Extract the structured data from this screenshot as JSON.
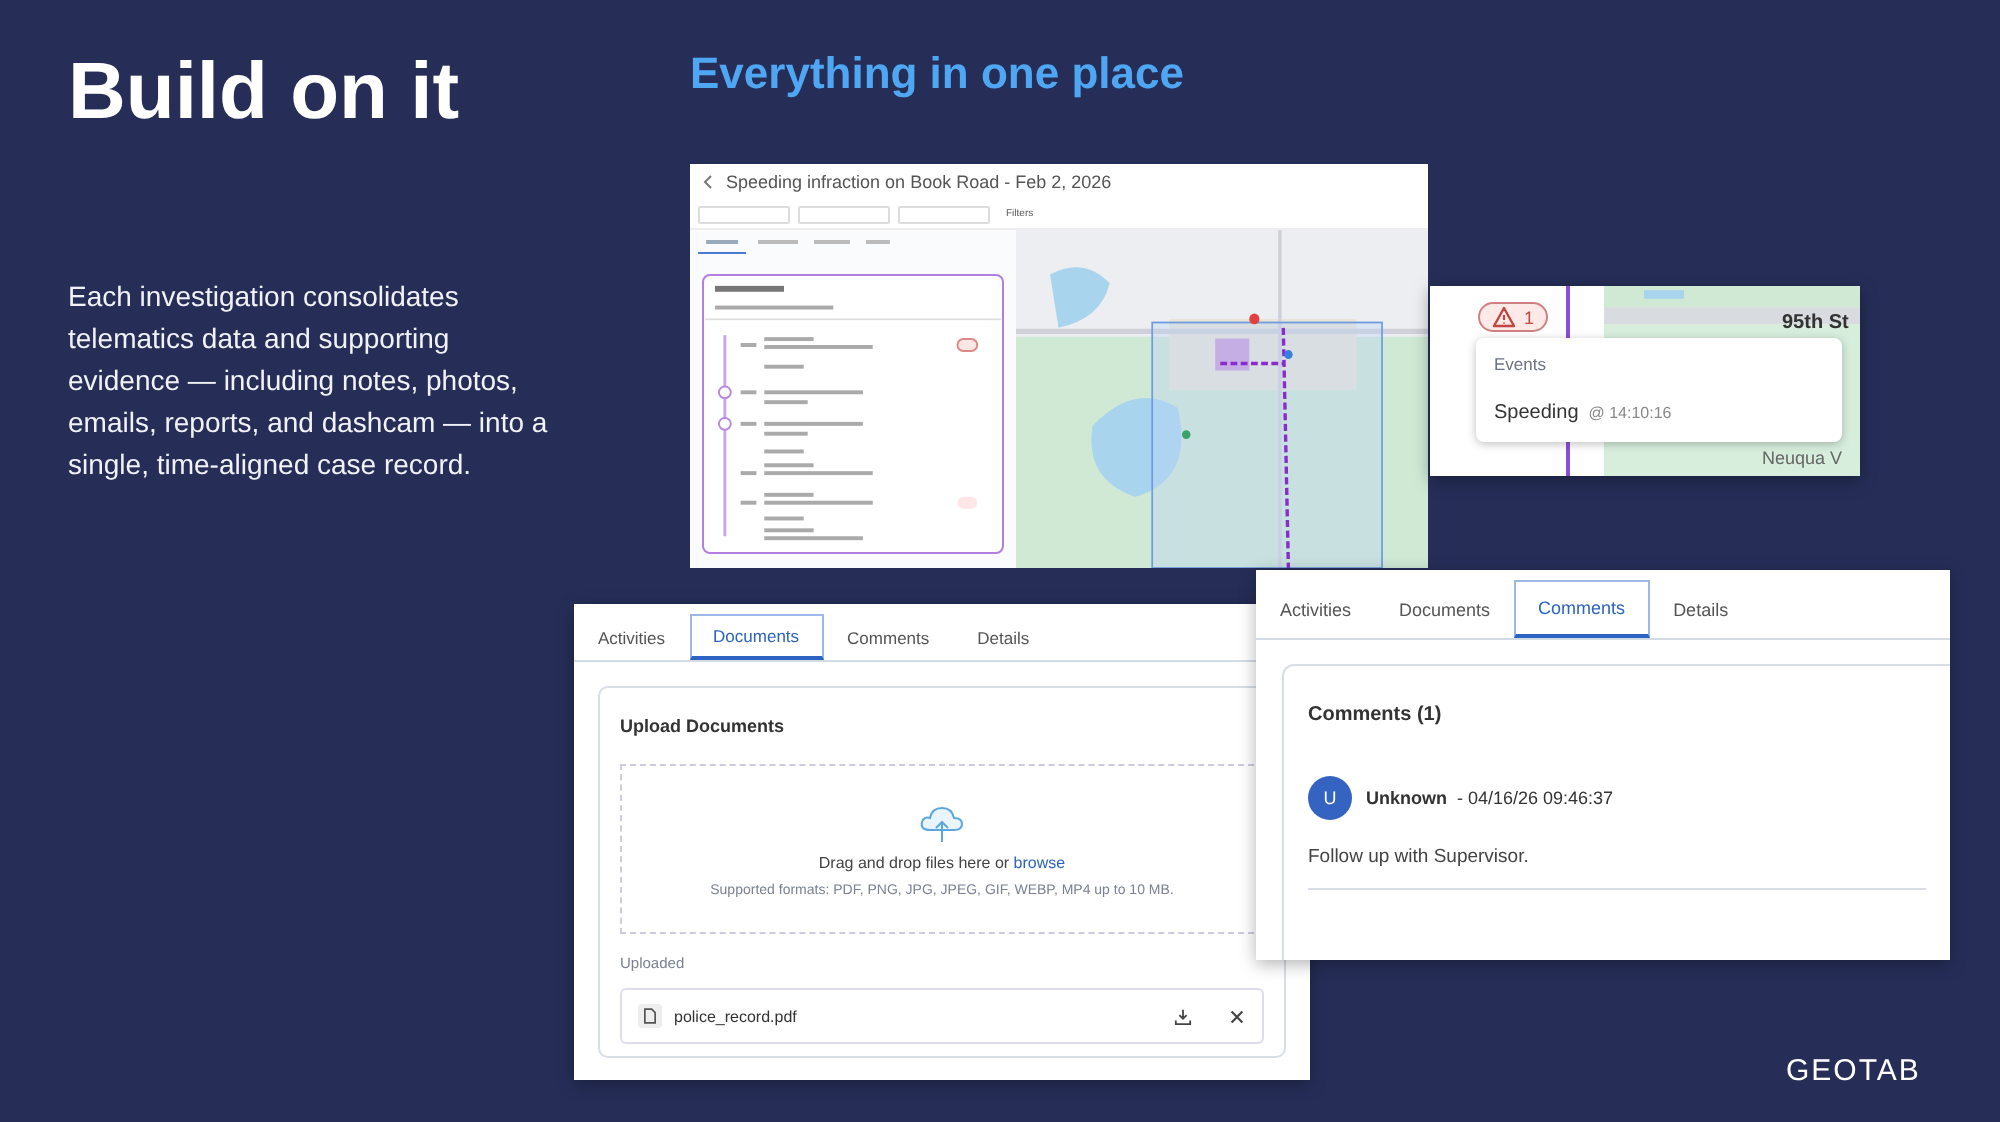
{
  "slide": {
    "title": "Build on it",
    "body": "Each investigation consolidates telematics data and supporting evidence — including notes, photos, emails, reports, and dashcam — into a single, time-aligned case record.",
    "heading": "Everything in one place",
    "logo": "GEOTAB"
  },
  "case_window": {
    "title": "Speeding infraction on Book Road - Feb 2, 2026",
    "filters": "Filters"
  },
  "callout": {
    "count": "1",
    "street": "95th St",
    "street_2": "Neuqua V",
    "tooltip_heading": "Events",
    "event": "Speeding",
    "time": "@ 14:10:16"
  },
  "documents_panel": {
    "tabs": [
      {
        "label": "Activities",
        "selected": false
      },
      {
        "label": "Documents",
        "selected": true
      },
      {
        "label": "Comments",
        "selected": false
      },
      {
        "label": "Details",
        "selected": false
      }
    ],
    "section_title": "Upload Documents",
    "drop_text": "Drag and drop files here or",
    "browse_link": "browse",
    "formats": "Supported formats: PDF, PNG, JPG, JPEG, GIF, WEBP, MP4 up to 10 MB.",
    "uploaded_label": "Uploaded",
    "files": [
      {
        "name": "police_record.pdf"
      }
    ]
  },
  "comments_panel": {
    "tabs": [
      {
        "label": "Activities",
        "selected": false
      },
      {
        "label": "Documents",
        "selected": false
      },
      {
        "label": "Comments",
        "selected": true
      },
      {
        "label": "Details",
        "selected": false
      }
    ],
    "heading": "Comments (1)",
    "comments": [
      {
        "avatar": "U",
        "author": "Unknown",
        "timestamp": "- 04/16/26 09:46:37",
        "text": "Follow up with Supervisor."
      }
    ]
  }
}
